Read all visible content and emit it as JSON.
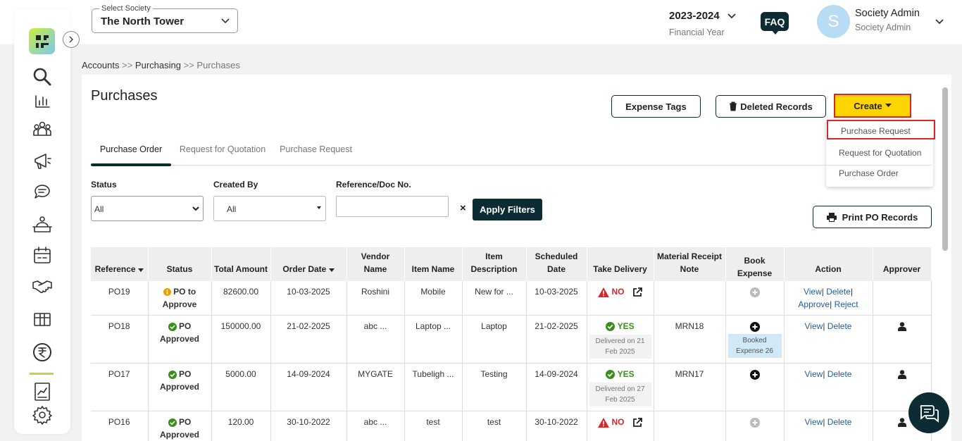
{
  "header": {
    "society_label": "Select Society",
    "society_value": "The North Tower",
    "financial_year": "2023-2024",
    "financial_year_label": "Financial Year",
    "faq": "FAQ",
    "avatar_letter": "S",
    "user_name": "Society Admin",
    "user_role": "Society Admin"
  },
  "sidebar": {
    "icons": [
      "search-icon",
      "bar-chart-icon",
      "people-icon",
      "megaphone-icon",
      "chat-icon",
      "helpdesk-icon",
      "calendar-icon",
      "handshake-icon",
      "inventory-icon",
      "rupee-icon",
      "report-icon",
      "settings-icon"
    ],
    "active_color": "#c8d23a"
  },
  "breadcrumb": {
    "accounts": "Accounts",
    "sep": ">>",
    "purchasing": "Purchasing",
    "current": "Purchases"
  },
  "page": {
    "title": "Purchases",
    "expense_tags": "Expense Tags",
    "deleted_records": "Deleted Records",
    "create": "Create",
    "create_menu": [
      "Purchase Request",
      "Request for Quotation",
      "Purchase Order"
    ],
    "tabs": [
      "Purchase Order",
      "Request for Quotation",
      "Purchase Request"
    ]
  },
  "filters": {
    "status_label": "Status",
    "status_value": "All",
    "created_by_label": "Created By",
    "created_by_value": "All",
    "ref_label": "Reference/Doc No.",
    "ref_value": "",
    "clear": "×",
    "apply": "Apply Filters",
    "print": "Print PO Records"
  },
  "table": {
    "headers": [
      "Reference",
      "Status",
      "Total Amount",
      "Order Date",
      "Vendor Name",
      "Item Name",
      "Item Description",
      "Scheduled Date",
      "Take Delivery",
      "Material Receipt Note",
      "Book Expense",
      "Action",
      "Approver"
    ],
    "rows": [
      {
        "ref": "PO19",
        "status": "PO to Approve",
        "amount": "82600.00",
        "order_date": "10-03-2025",
        "vendor": "Roshini",
        "item": "Mobile",
        "desc": "New for ...",
        "sched": "10-03-2025",
        "delivery": "NO",
        "delivered_on": "",
        "mrn": "",
        "booked": "",
        "actions": [
          "View",
          "Delete",
          "Approve",
          "Reject"
        ]
      },
      {
        "ref": "PO18",
        "status": "PO Approved",
        "amount": "150000.00",
        "order_date": "21-02-2025",
        "vendor": "abc ...",
        "item": "Laptop ...",
        "desc": "Laptop",
        "sched": "21-02-2025",
        "delivery": "YES",
        "delivered_on": "Delivered on 21 Feb 2025",
        "mrn": "MRN18",
        "booked": "Booked Expense 26",
        "actions": [
          "View",
          "Delete"
        ]
      },
      {
        "ref": "PO17",
        "status": "PO Approved",
        "amount": "5000.00",
        "order_date": "14-09-2024",
        "vendor": "MYGATE",
        "item": "Tubeligh ...",
        "desc": "Testing",
        "sched": "14-09-2024",
        "delivery": "YES",
        "delivered_on": "Delivered on 27 Feb 2025",
        "mrn": "MRN17",
        "booked": "",
        "actions": [
          "View",
          "Delete"
        ]
      },
      {
        "ref": "PO16",
        "status": "PO Approved",
        "amount": "120.00",
        "order_date": "30-10-2022",
        "vendor": "abc ...",
        "item": "test",
        "desc": "test",
        "sched": "30-10-2022",
        "delivery": "NO",
        "delivered_on": "",
        "mrn": "",
        "booked": "",
        "actions": [
          "View",
          "Delete"
        ]
      }
    ]
  },
  "colors": {
    "brand_dark": "#0d2b33",
    "create_yellow": "#ffd500",
    "highlight_red": "#d9262b",
    "approved_green": "#3a8f1a",
    "pending_orange": "#e8a000",
    "link_blue": "#1f5d9c"
  }
}
